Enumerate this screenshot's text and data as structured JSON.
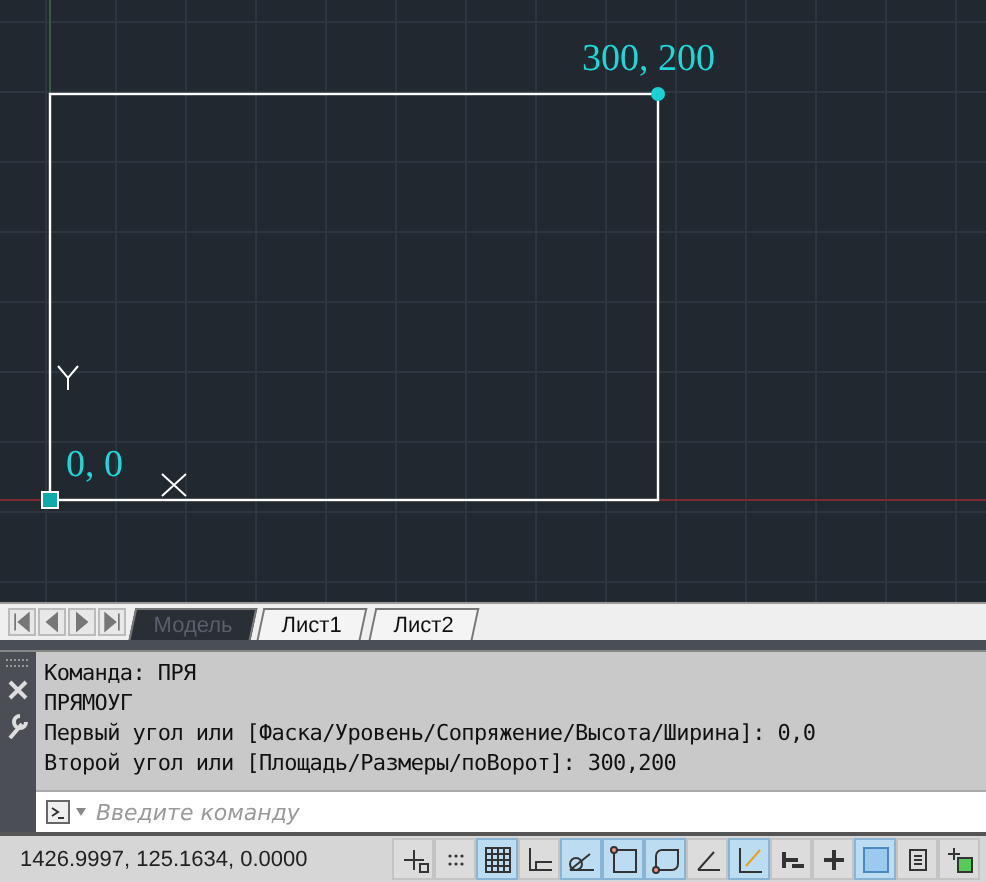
{
  "canvas": {
    "points": [
      {
        "label": "300, 200"
      },
      {
        "label": "0, 0"
      }
    ]
  },
  "sheet_tabs": [
    {
      "label": "Модель",
      "selected": true
    },
    {
      "label": "Лист1",
      "selected": false
    },
    {
      "label": "Лист2",
      "selected": false
    }
  ],
  "command_history": [
    "Команда: ПРЯ",
    "ПРЯМОУГ",
    "Первый угол или [Фаска/Уровень/Сопряжение/Высота/Ширина]: 0,0",
    "Второй угол или [Площадь/Размеры/поВорот]: 300,200"
  ],
  "command_input": {
    "placeholder": "Введите команду"
  },
  "status_bar": {
    "coordinates": "1426.9997, 125.1634, 0.0000",
    "toggles": [
      {
        "on": false
      },
      {
        "on": false
      },
      {
        "on": true
      },
      {
        "on": false
      },
      {
        "on": true
      },
      {
        "on": true
      },
      {
        "on": true
      },
      {
        "on": false
      },
      {
        "on": true
      },
      {
        "on": false
      },
      {
        "on": false
      },
      {
        "on": true
      },
      {
        "on": false
      },
      {
        "on": false
      }
    ]
  }
}
